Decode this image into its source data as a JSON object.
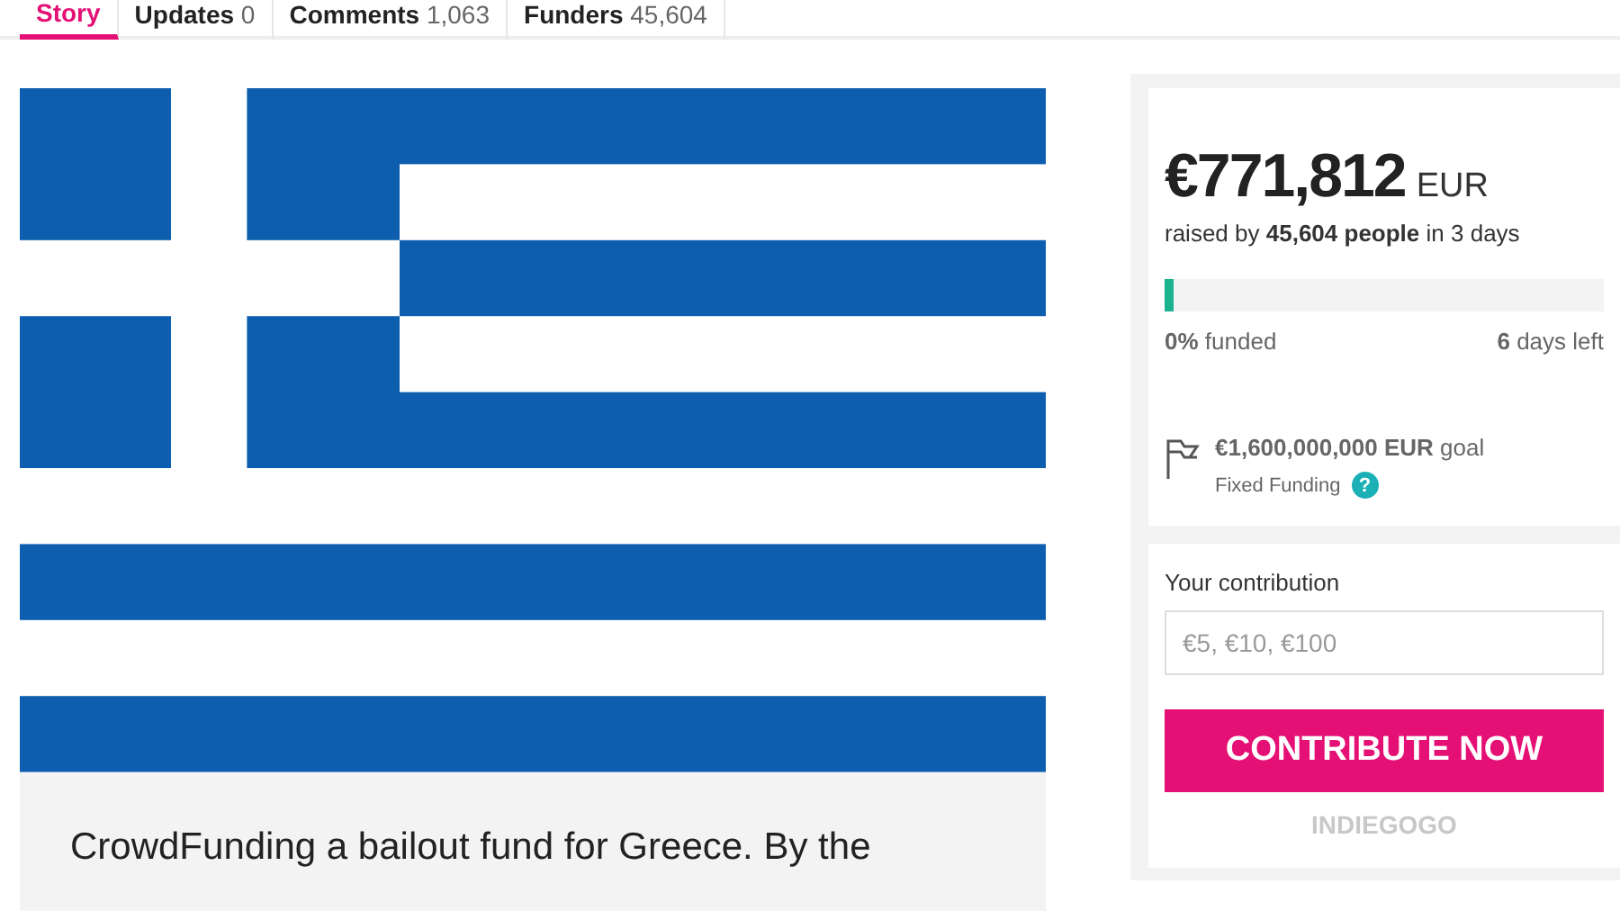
{
  "tabs": [
    {
      "label": "Story",
      "selected": true
    },
    {
      "label": "Updates",
      "count": "0",
      "selected": false
    },
    {
      "label": "Comments",
      "count": "1,063",
      "selected": false
    },
    {
      "label": "Funders",
      "count": "45,604",
      "selected": false
    }
  ],
  "campaign": {
    "kind": "picture",
    "story": "CrowdFunding a bailout fund for Greece. By the"
  },
  "funding": {
    "amount": "€771,812",
    "currency": "EUR",
    "raised_by": "raised by **45,604 people** in 3 days",
    "level": 0.02,
    "funded": "**0%** funded",
    "days_left": "**6** days left",
    "goal": "**€1,600,000,000 EUR** goal",
    "funding_type": "Fixed Funding",
    "help": "?"
  },
  "contribute": {
    "label": "Your contribution",
    "placeholder": "€5, €10, €100",
    "button": "CONTRIBUTE NOW",
    "brand": "INDIEGOGO"
  }
}
